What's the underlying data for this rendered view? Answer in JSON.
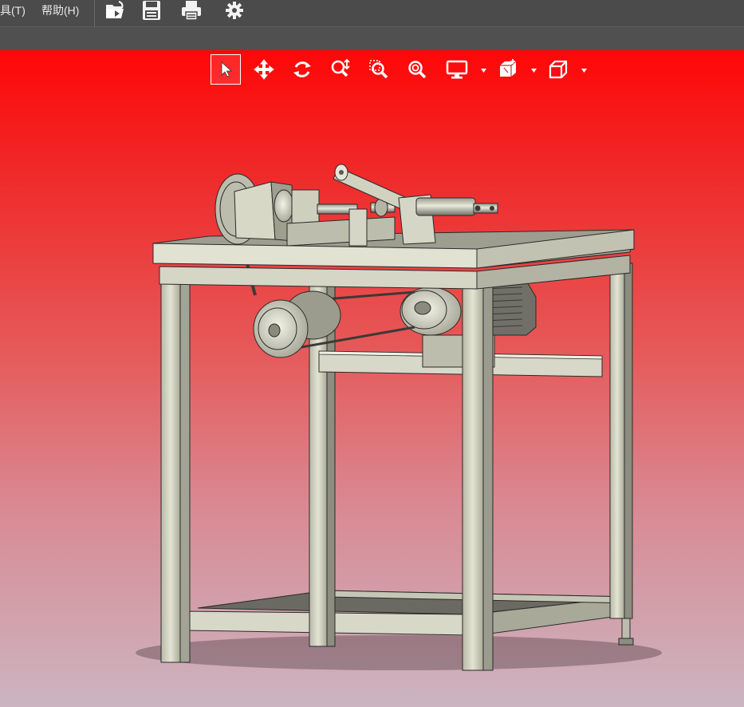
{
  "menubar": {
    "tools_label": "具(T)",
    "help_label": "帮助(H)"
  },
  "quick_access": {
    "icons": [
      "open-icon",
      "save-icon",
      "print-icon",
      "options-gear-icon"
    ]
  },
  "heads_up_toolbar": {
    "tools": [
      "select-arrow-icon",
      "pan-icon",
      "rotate-icon",
      "zoom-to-fit-icon",
      "zoom-to-area-icon",
      "zoom-in-out-icon",
      "display-style-icon",
      "section-view-icon",
      "view-orientation-icon"
    ],
    "active_tool": "select-arrow-icon"
  },
  "viewport": {
    "background_top": "#ff0707",
    "background_bottom": "#cbb5c0",
    "model_color": "#d9d9c8"
  }
}
